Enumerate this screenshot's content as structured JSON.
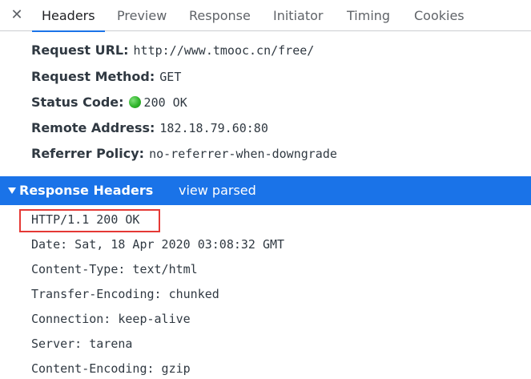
{
  "tabs": {
    "close_icon": "✕",
    "items": [
      "Headers",
      "Preview",
      "Response",
      "Initiator",
      "Timing",
      "Cookies"
    ],
    "active": "Headers"
  },
  "general": {
    "request_url": {
      "key": "Request URL:",
      "value": "http://www.tmooc.cn/free/"
    },
    "request_method": {
      "key": "Request Method:",
      "value": "GET"
    },
    "status_code": {
      "key": "Status Code:",
      "value": "200 OK",
      "status_color": "#2fb52a"
    },
    "remote_address": {
      "key": "Remote Address:",
      "value": "182.18.79.60:80"
    },
    "referrer_policy": {
      "key": "Referrer Policy:",
      "value": "no-referrer-when-downgrade"
    }
  },
  "response_headers": {
    "title": "Response Headers",
    "toggle_label": "view parsed",
    "lines": [
      "HTTP/1.1 200 OK",
      "Date: Sat, 18 Apr 2020 03:08:32 GMT",
      "Content-Type: text/html",
      "Transfer-Encoding: chunked",
      "Connection: keep-alive",
      "Server: tarena",
      "Content-Encoding: gzip"
    ]
  },
  "colors": {
    "accent": "#1a73e8",
    "highlight": "#e53935"
  }
}
